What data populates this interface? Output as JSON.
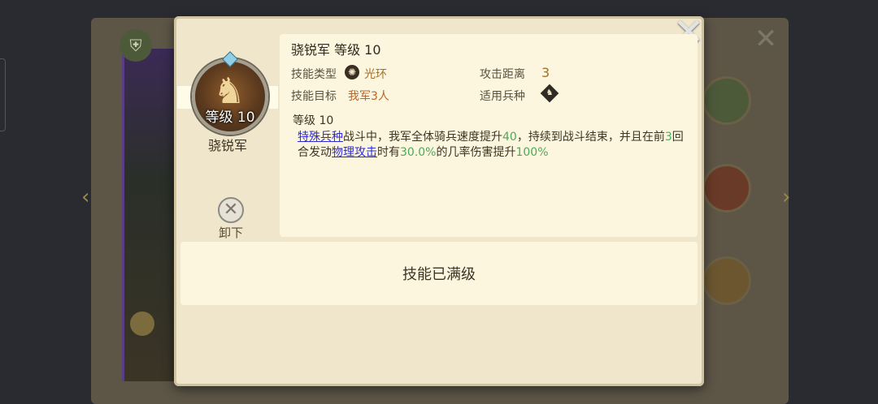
{
  "skill": {
    "name": "骁锐军",
    "level_badge": "等级 10",
    "title": "骁锐军 等级 10",
    "level_line": "等级 10"
  },
  "labels": {
    "skill_type": "技能类型",
    "skill_target": "技能目标",
    "attack_range": "攻击距离",
    "troop_type": "适用兵种"
  },
  "values": {
    "skill_type": "光环",
    "skill_target": "我军3人",
    "attack_range": "3"
  },
  "description": {
    "link1": "特殊兵种",
    "t1": "战斗中，我军全体骑兵速度提升",
    "n1": "40",
    "t2": "，持续到战斗结束，并且在前",
    "n2": "3",
    "t3": "回合发动",
    "link2": "物理攻击",
    "t4": "时有",
    "n3": "30.0%",
    "t5": "的几率伤害提升",
    "n4": "100%"
  },
  "unequip_label": "卸下",
  "max_level_text": "技能已满级",
  "icons": {
    "close": "close-icon",
    "aura": "aura-icon",
    "troop": "cavalry-icon",
    "unequip": "unequip-icon"
  },
  "colors": {
    "modal_bg": "#efe6cb",
    "card_bg": "#fdf6df",
    "link": "#2d2bd8",
    "number": "#4ea85a",
    "value": "#a0702a"
  }
}
